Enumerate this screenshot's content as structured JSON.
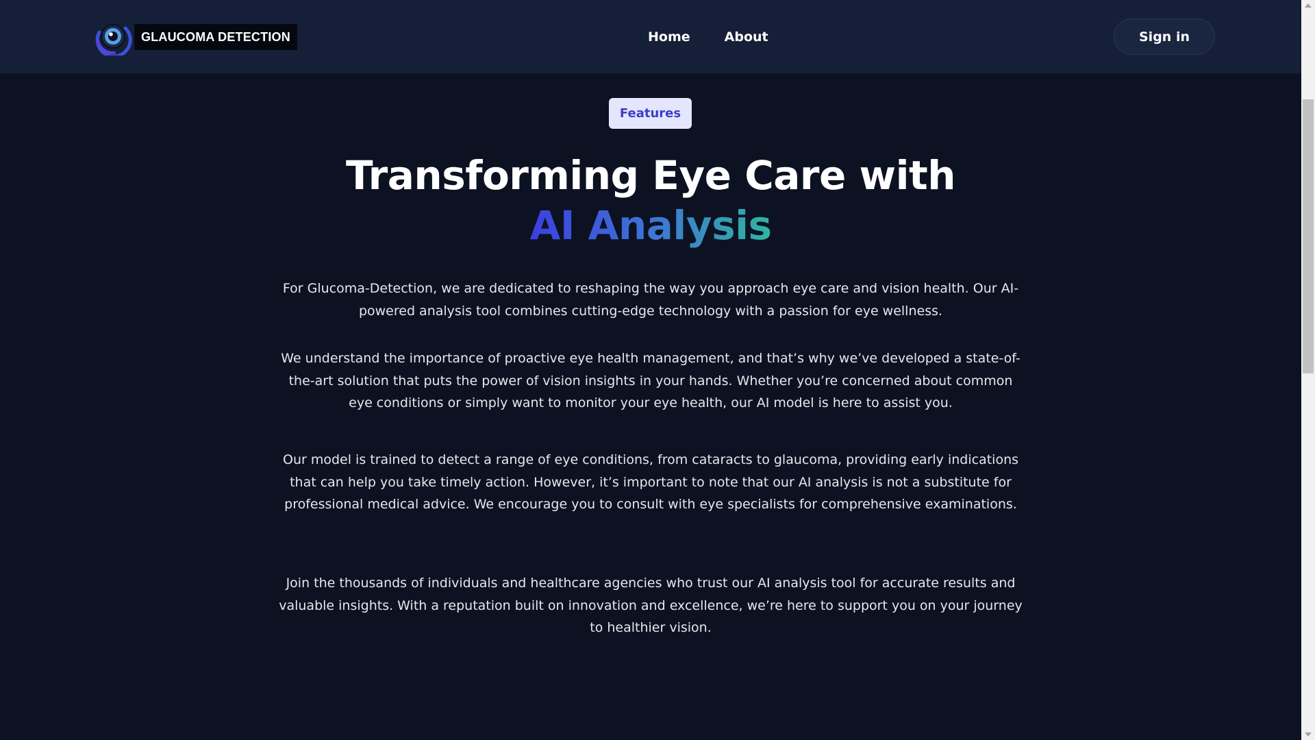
{
  "brand": {
    "logo_icon": "eye-logo-icon",
    "name": "GLAUCOMA DETECTION"
  },
  "nav": {
    "links": [
      {
        "label": "Home"
      },
      {
        "label": "About"
      }
    ],
    "signin_label": "Sign in"
  },
  "hero": {
    "badge": "Features",
    "title_line1": "Transforming Eye Care with",
    "title_line2": "AI Analysis",
    "gradient_colors": [
      "#3b3fe0",
      "#3f74d6",
      "#2fb5a0"
    ]
  },
  "paragraphs": [
    "For Glucoma-Detection, we are dedicated to reshaping the way you approach eye care and vision health. Our AI-powered analysis tool combines cutting-edge technology with a passion for eye wellness.",
    "We understand the importance of proactive eye health management, and that’s why we’ve developed a state-of-the-art solution that puts the power of vision insights in your hands. Whether you’re concerned about common eye conditions or simply want to monitor your eye health, our AI model is here to assist you.",
    "Our model is trained to detect a range of eye conditions, from cataracts to glaucoma, providing early indications that can help you take timely action. However, it’s important to note that our AI analysis is not a substitute for professional medical advice. We encourage you to consult with eye specialists for comprehensive examinations.",
    "Join the thousands of individuals and healthcare agencies who trust our AI analysis tool for accurate results and valuable insights. With a reputation built on innovation and excellence, we’re here to support you on your journey to healthier vision."
  ],
  "colors": {
    "page_background": "#0d1222",
    "navbar_background": "#151f38",
    "badge_background": "#e3e6fd",
    "badge_text": "#3a3fc8"
  }
}
